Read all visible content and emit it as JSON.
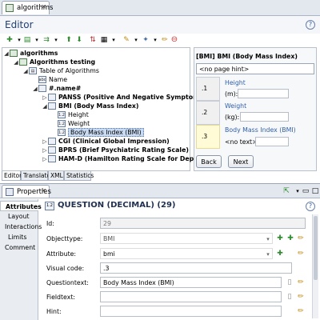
{
  "top_tab": {
    "label": "algorithms",
    "close": "✕"
  },
  "editor": {
    "title": "Editor",
    "help": "?",
    "tree": [
      {
        "label": "algorithms",
        "bold": true
      },
      {
        "label": "Algorithms testing",
        "bold": true
      },
      {
        "label": "Table of Algorithms",
        "bold": false
      },
      {
        "label": "Name",
        "bold": false
      },
      {
        "label": "#.name#",
        "bold": true
      },
      {
        "label": "PANSS (Positive And Negative Symptom Scale)",
        "bold": true
      },
      {
        "label": "BMI (Body Mass Index)",
        "bold": true
      },
      {
        "label": "Height",
        "bold": false
      },
      {
        "label": "Weight",
        "bold": false
      },
      {
        "label": "Body Mass Index (BMI)",
        "bold": false
      },
      {
        "label": "CGI (Clinical Global Impression)",
        "bold": true
      },
      {
        "label": "BPRS (Brief Psychiatric Rating Scale)",
        "bold": true
      },
      {
        "label": "HAM-D (Hamilton Rating Scale for Depression)",
        "bold": true
      }
    ],
    "preview": {
      "title": "[BMI]  BMI (Body Mass Index)",
      "page_hint": "<no page hint>",
      "items": [
        {
          "num": ".1",
          "label": "Height",
          "unit": "(m):"
        },
        {
          "num": ".2",
          "label": "Weight",
          "unit": "(kg):"
        },
        {
          "num": ".3",
          "label": "Body Mass Index (BMI)",
          "unit": "<no text>:"
        }
      ],
      "back": "Back",
      "next": "Next"
    },
    "bottom_tabs": [
      "Editor",
      "Translator",
      "XML",
      "Statistics"
    ]
  },
  "properties": {
    "tab": "Properties",
    "side": [
      "Attributes",
      "Layout",
      "Interactions",
      "Limits",
      "Comment"
    ],
    "heading": "QUESTION (DECIMAL) (29)",
    "help": "?",
    "fields": [
      {
        "label": "Id:",
        "value": "29"
      },
      {
        "label": "Objecttype:",
        "value": "BMI"
      },
      {
        "label": "Attribute:",
        "value": "bmi"
      },
      {
        "label": "Visual code:",
        "value": ".3"
      },
      {
        "label": "Questiontext:",
        "value": "Body Mass Index (BMI)"
      },
      {
        "label": "Fieldtext:",
        "value": ""
      },
      {
        "label": "Hint:",
        "value": ""
      }
    ]
  },
  "colors": {
    "accent": "#2f5fa8",
    "selection": "#c9dbf2",
    "preview_highlight": "#fffbd6",
    "panel_border": "#9aa5b8"
  }
}
